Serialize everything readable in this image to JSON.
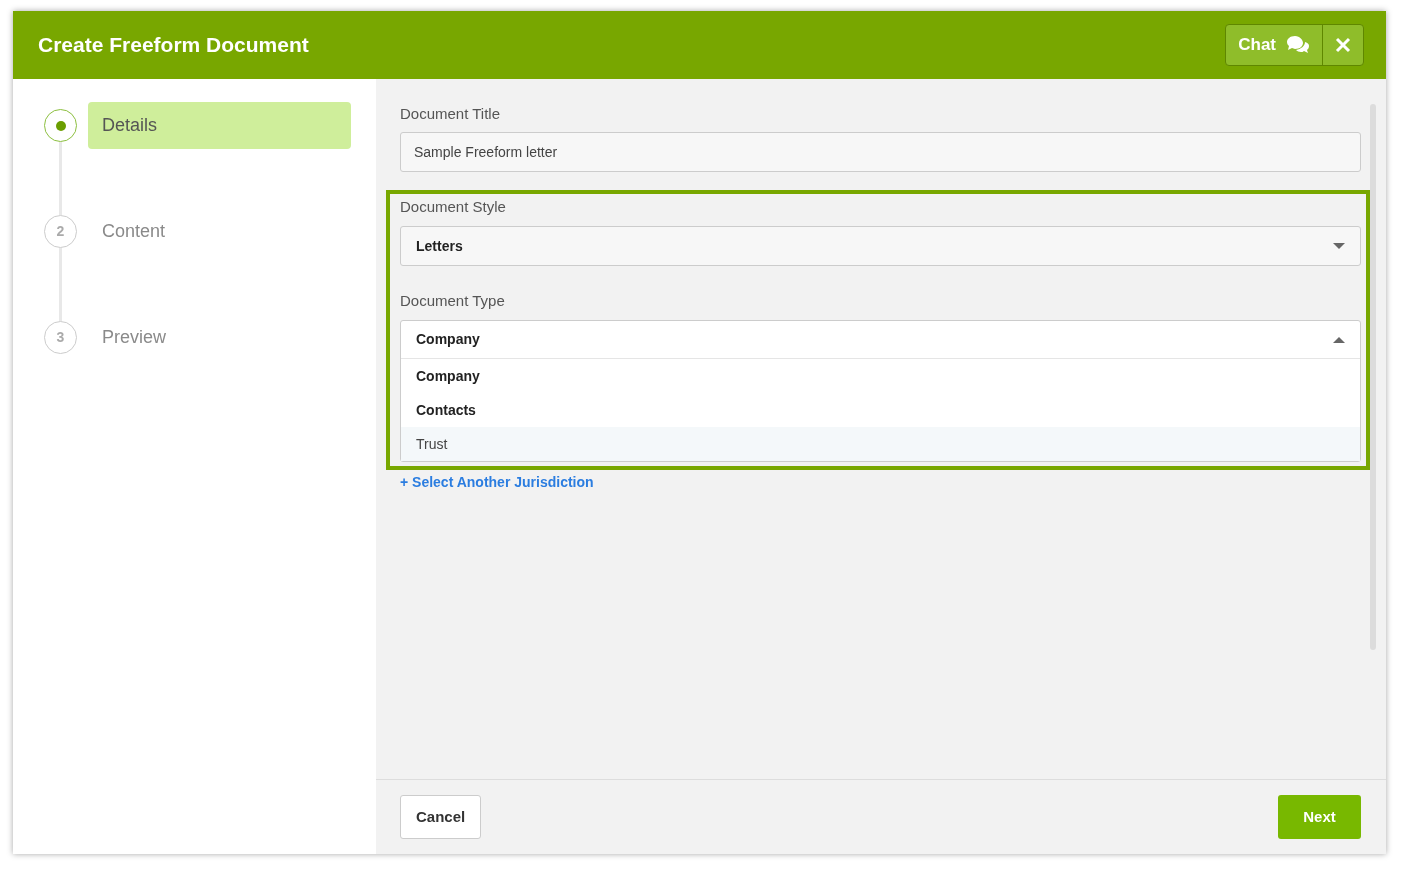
{
  "dialog": {
    "title": "Create Freeform Document",
    "chat_button": "Chat"
  },
  "steps": [
    {
      "label": "Details",
      "selected": true
    },
    {
      "marker": "2",
      "label": "Content",
      "selected": false
    },
    {
      "marker": "3",
      "label": "Preview",
      "selected": false
    }
  ],
  "form": {
    "title_label": "Document Title",
    "title_value": "Sample Freeform letter",
    "style_label": "Document Style",
    "style_value": "Letters",
    "type_label": "Document Type",
    "type_value": "Company",
    "type_expanded": true,
    "type_options": [
      {
        "label": "Company",
        "highlighted": false
      },
      {
        "label": "Contacts",
        "highlighted": false
      },
      {
        "label": "Trust",
        "highlighted": true
      }
    ],
    "link": "+ Select Another Jurisdiction"
  },
  "footer": {
    "cancel": "Cancel",
    "next": "Next"
  }
}
